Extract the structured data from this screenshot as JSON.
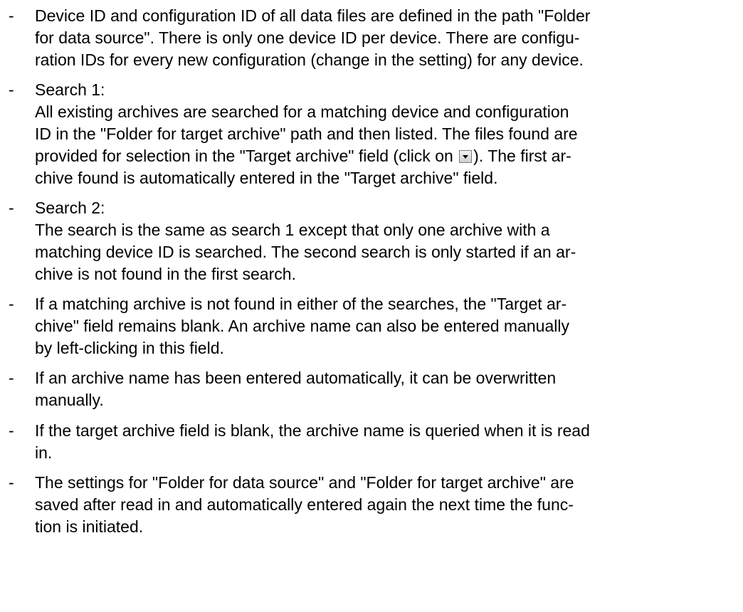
{
  "bullet": "-",
  "items": [
    {
      "lines": [
        "Device ID and configuration ID of all data files are defined in the path \"Folder",
        "for data source\". There is only one device ID per device. There are configu-",
        "ration IDs for every new configuration (change in the setting) for any device."
      ]
    },
    {
      "lines": [
        "Search 1:",
        "All existing archives are searched for a matching device and configuration",
        "ID in the \"Folder for target archive\" path and then listed. The files found are"
      ],
      "line3_before": "provided for selection in the \"Target archive\" field (click on ",
      "line3_after": "). The first ar-",
      "line3_icon": "dropdown-arrow-icon",
      "line4": "chive found is automatically entered in the \"Target archive\" field."
    },
    {
      "lines": [
        "Search 2:",
        "The search is the same as search 1 except that only one archive with a",
        "matching device ID is searched. The second search is only started if an ar-",
        "chive is not found in the first search."
      ]
    },
    {
      "lines": [
        "If a matching archive is not found in either of the searches, the \"Target ar-",
        "chive\" field remains blank. An archive name can also be entered manually",
        "by left-clicking in this field."
      ]
    },
    {
      "lines": [
        "If an archive name has been entered automatically, it can be overwritten",
        "manually."
      ]
    },
    {
      "lines": [
        "If the target archive field is blank, the archive name is queried when it is read",
        "in."
      ]
    },
    {
      "lines": [
        "The settings for \"Folder for data source\" and \"Folder for target archive\" are",
        "saved after read in and automatically entered again the next time the func-",
        "tion is initiated."
      ]
    }
  ]
}
